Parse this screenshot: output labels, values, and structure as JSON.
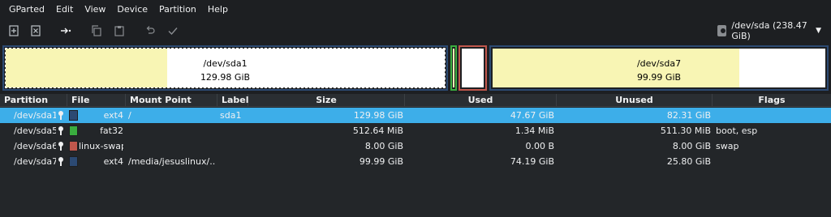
{
  "menubar": {
    "items": [
      "GParted",
      "Edit",
      "View",
      "Device",
      "Partition",
      "Help"
    ]
  },
  "toolbar": {
    "buttons": [
      {
        "name": "new-partition-icon",
        "label": "New"
      },
      {
        "name": "delete-partition-icon",
        "label": "Delete"
      },
      {
        "name": "resize-move-icon",
        "label": "Resize/Move"
      },
      {
        "name": "copy-icon",
        "label": "Copy"
      },
      {
        "name": "paste-icon",
        "label": "Paste"
      },
      {
        "name": "undo-icon",
        "label": "Undo"
      },
      {
        "name": "apply-icon",
        "label": "Apply"
      }
    ],
    "device": "/dev/sda (238.47 GiB)"
  },
  "diskmap": {
    "sda1": {
      "name": "/dev/sda1",
      "size": "129.98 GiB",
      "used_fraction": 0.367,
      "color": "#2c4a73"
    },
    "sda5": {
      "color": "#3aad3f"
    },
    "sda6": {
      "color": "#c0574c"
    },
    "sda7": {
      "name": "/dev/sda7",
      "size": "99.99 GiB",
      "used_fraction": 0.742,
      "color": "#2c4a73"
    }
  },
  "table": {
    "headers": [
      "Partition",
      "File System",
      "Mount Point",
      "Label",
      "Size",
      "Used",
      "Unused",
      "Flags"
    ],
    "rows": [
      {
        "partition": "/dev/sda1",
        "fs": "ext4",
        "fs_color": "#2c4a73",
        "mount": "/",
        "label": "sda1",
        "size": "129.98 GiB",
        "used": "47.67 GiB",
        "unused": "82.31 GiB",
        "flags": "",
        "selected": true
      },
      {
        "partition": "/dev/sda5",
        "fs": "fat32",
        "fs_color": "#3aad3f",
        "mount": "",
        "label": "",
        "size": "512.64 MiB",
        "used": "1.34 MiB",
        "unused": "511.30 MiB",
        "flags": "boot, esp",
        "selected": false
      },
      {
        "partition": "/dev/sda6",
        "fs": "linux-swap",
        "fs_color": "#c0574c",
        "mount": "",
        "label": "",
        "size": "8.00 GiB",
        "used": "0.00 B",
        "unused": "8.00 GiB",
        "flags": "swap",
        "selected": false
      },
      {
        "partition": "/dev/sda7",
        "fs": "ext4",
        "fs_color": "#2c4a73",
        "mount": "/media/jesuslinux/...",
        "label": "",
        "size": "99.99 GiB",
        "used": "74.19 GiB",
        "unused": "25.80 GiB",
        "flags": "",
        "selected": false
      }
    ]
  }
}
